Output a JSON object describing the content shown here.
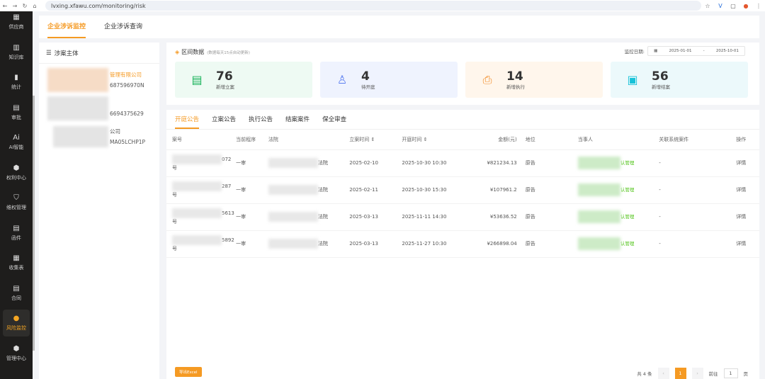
{
  "browser": {
    "url": "lvxing.xfawu.com/monitoring/risk"
  },
  "sidebar": {
    "items": [
      {
        "label": "供应商",
        "icon": "supplier-icon"
      },
      {
        "label": "知识库",
        "icon": "book-icon"
      },
      {
        "label": "统计",
        "icon": "chart-icon"
      },
      {
        "label": "审批",
        "icon": "approve-icon"
      },
      {
        "label": "AI智能",
        "icon": "ai-icon"
      },
      {
        "label": "权利中心",
        "icon": "hexagon-icon"
      },
      {
        "label": "维权管理",
        "icon": "shield-icon"
      },
      {
        "label": "函件",
        "icon": "letter-icon"
      },
      {
        "label": "收集表",
        "icon": "form-icon"
      },
      {
        "label": "合同",
        "icon": "contract-icon"
      },
      {
        "label": "风险监控",
        "icon": "risk-icon"
      },
      {
        "label": "管理中心",
        "icon": "cube-icon"
      }
    ]
  },
  "top_tabs": [
    "企业涉诉监控",
    "企业涉诉查询"
  ],
  "left_panel": {
    "title": "涉案主体",
    "entities": [
      {
        "name": "管理有限公司",
        "code": "687596970N"
      },
      {
        "name": "",
        "code": "6694375629"
      },
      {
        "name": "公司",
        "code": "MA05LCHP1P"
      }
    ]
  },
  "stats": {
    "title": "区间数据",
    "subtitle": "(数据每天15点自动更新)",
    "date_label": "监控日期:",
    "date_start": "2025-01-01",
    "date_sep": "-",
    "date_end": "2025-10-01",
    "cards": [
      {
        "value": "76",
        "label": "新增立案",
        "color": "#19b35a",
        "bg": "#eefaf3"
      },
      {
        "value": "4",
        "label": "待开庭",
        "color": "#5b7ef0",
        "bg": "#eff3fe"
      },
      {
        "value": "14",
        "label": "新增执行",
        "color": "#f28c28",
        "bg": "#fff6ec"
      },
      {
        "value": "56",
        "label": "新增结案",
        "color": "#17c2d8",
        "bg": "#ecf9fb"
      }
    ]
  },
  "tabs": [
    "开庭公告",
    "立案公告",
    "执行公告",
    "结案案件",
    "保全审查"
  ],
  "table": {
    "headers": [
      "案号",
      "当前程序",
      "法院",
      "立案时间 ⇕",
      "开庭时间 ⇕",
      "金额(元)",
      "地位",
      "当事人",
      "关联系统案件",
      "操作"
    ],
    "rows": [
      {
        "case": "072号",
        "stage": "一审",
        "court": "法院",
        "filed": "2025-02-10",
        "hearing": "2025-10-30 10:30",
        "amount": "¥821234.13",
        "role": "原告",
        "party": "认管理",
        "linked": "-",
        "action": "详情"
      },
      {
        "case": "287号",
        "stage": "一审",
        "court": "法院",
        "filed": "2025-02-11",
        "hearing": "2025-10-30 15:30",
        "amount": "¥107961.2",
        "role": "原告",
        "party": "认管理",
        "linked": "-",
        "action": "详情"
      },
      {
        "case": "5613号",
        "stage": "一审",
        "court": "法院",
        "filed": "2025-03-13",
        "hearing": "2025-11-11 14:30",
        "amount": "¥53636.52",
        "role": "原告",
        "party": "认管理",
        "linked": "-",
        "action": "详情"
      },
      {
        "case": "5892号",
        "stage": "一审",
        "court": "法院",
        "filed": "2025-03-13",
        "hearing": "2025-11-27 10:30",
        "amount": "¥266898.04",
        "role": "原告",
        "party": "认管理",
        "linked": "-",
        "action": "详情"
      }
    ]
  },
  "footer": {
    "export": "导出Excel",
    "total": "共 4 条",
    "prev": "‹",
    "page": "1",
    "next": "›",
    "goto": "前往",
    "goto_value": "1",
    "page_unit": "页"
  }
}
